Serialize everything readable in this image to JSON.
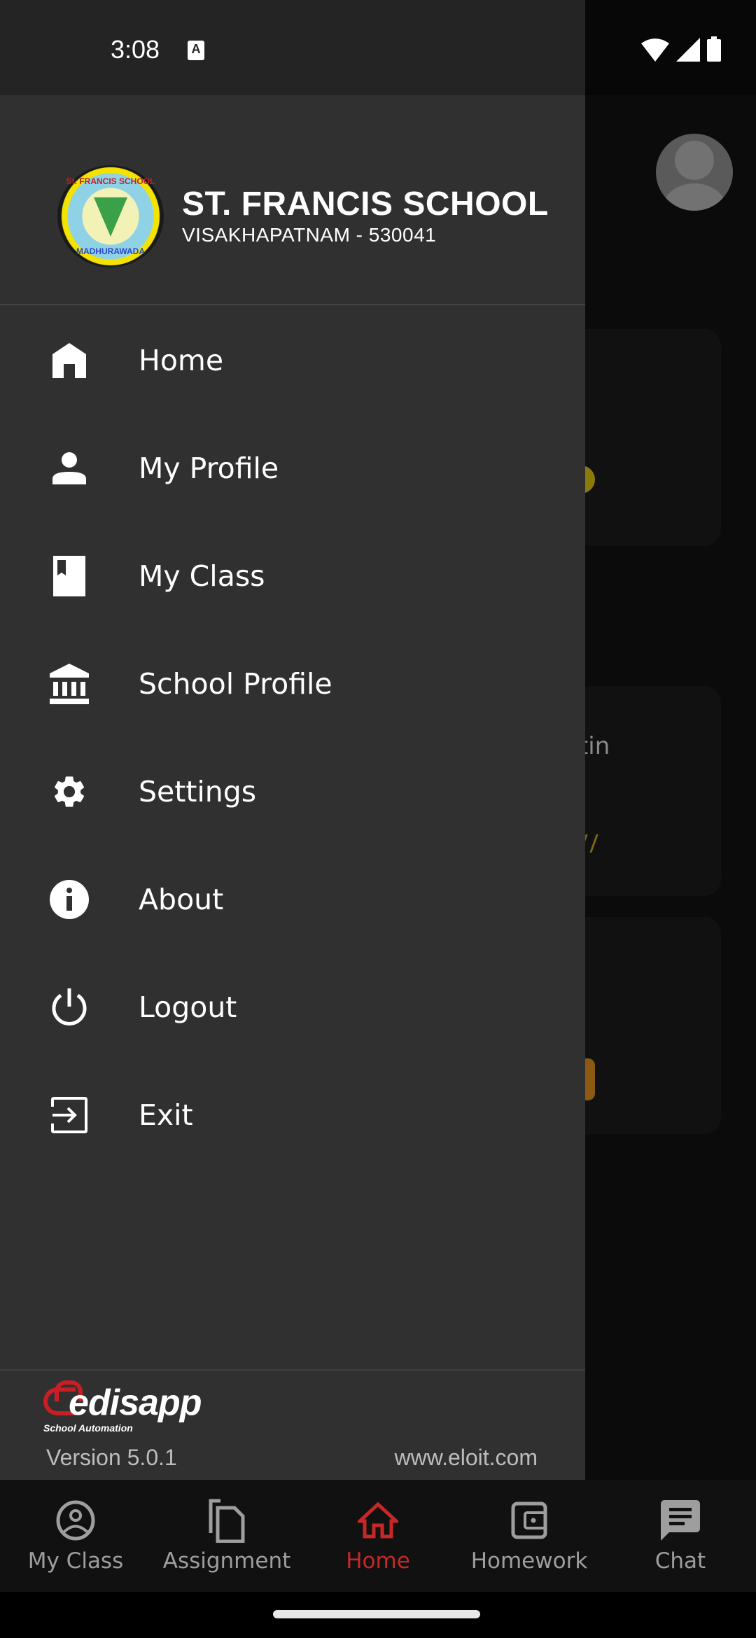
{
  "status_bar": {
    "time": "3:08",
    "notification_icon": "a-text-icon",
    "icons": [
      "wifi-icon",
      "cellular-signal-icon",
      "battery-icon"
    ]
  },
  "drawer": {
    "school_name": "ST. FRANCIS SCHOOL",
    "school_address": "VISAKHAPATNAM - 530041",
    "logo": {
      "ring_top": "St. FRANCIS SCHOOL",
      "ring_bottom": "MADHURAWADA"
    },
    "menu": [
      {
        "label": "Home",
        "icon": "home-icon"
      },
      {
        "label": "My Profile",
        "icon": "person-icon"
      },
      {
        "label": "My Class",
        "icon": "bookmark-book-icon"
      },
      {
        "label": "School Profile",
        "icon": "institution-icon"
      },
      {
        "label": "Settings",
        "icon": "gear-icon"
      },
      {
        "label": "About",
        "icon": "info-icon"
      },
      {
        "label": "Logout",
        "icon": "power-icon"
      },
      {
        "label": "Exit",
        "icon": "exit-icon"
      }
    ],
    "footer": {
      "brand": "edisapp",
      "tagline": "School Automation",
      "version": "Version 5.0.1",
      "website": "www.eloit.com"
    }
  },
  "background": {
    "partial_text_1": "t",
    "partial_text_2": "etin"
  },
  "bottom_nav": {
    "active_index": 2,
    "active_color": "#c62828",
    "inactive_color": "#9e9e9e",
    "tabs": [
      {
        "label": "My Class",
        "icon": "account-circle-icon"
      },
      {
        "label": "Assignment",
        "icon": "copy-document-icon"
      },
      {
        "label": "Home",
        "icon": "home-outline-icon"
      },
      {
        "label": "Homework",
        "icon": "wallet-icon"
      },
      {
        "label": "Chat",
        "icon": "chat-icon"
      }
    ]
  },
  "colors": {
    "drawer_bg": "#303030",
    "status_bar_bg": "#242424",
    "brand_red": "#c81e25",
    "background_dim": "#0b0b0b"
  }
}
